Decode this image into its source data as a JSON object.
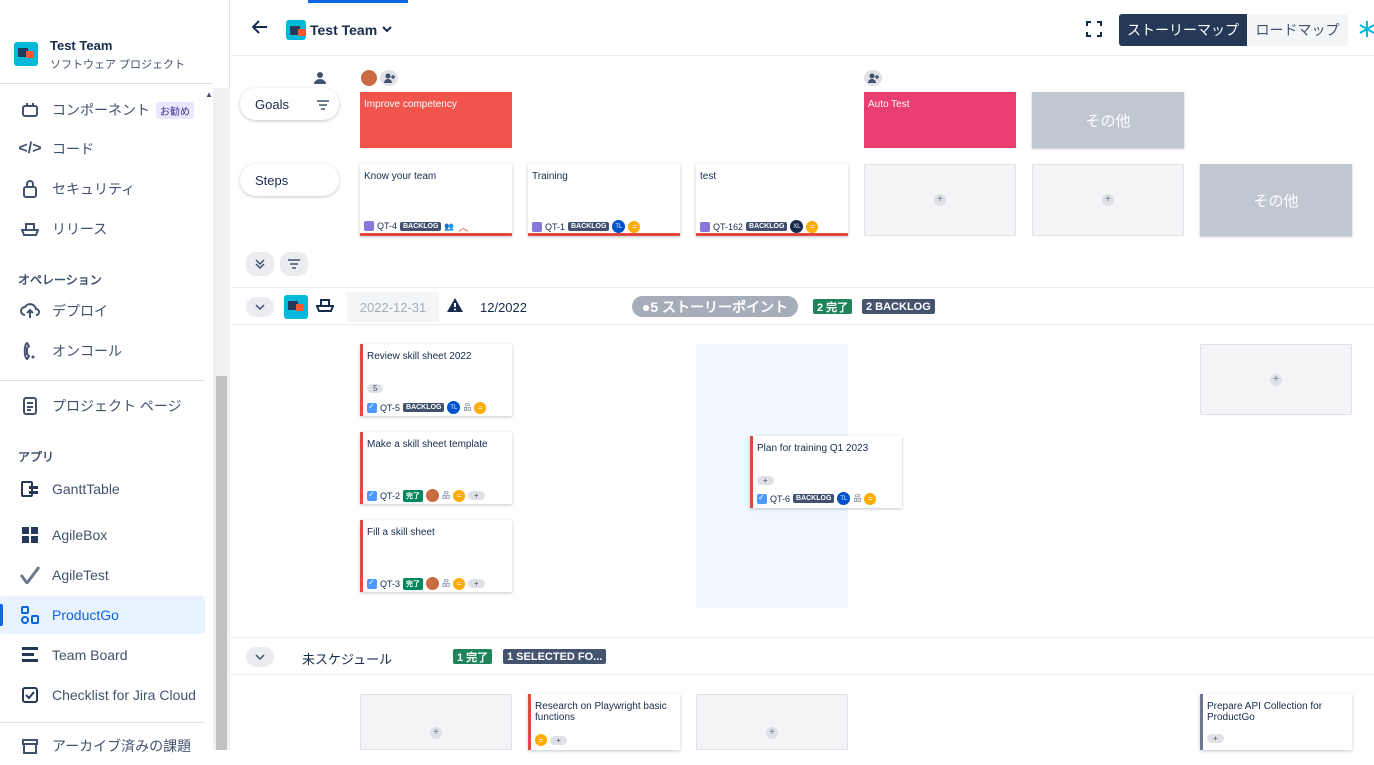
{
  "project": {
    "name": "Test Team",
    "type": "ソフトウェア プロジェクト"
  },
  "sidebar": {
    "items": [
      {
        "label": "コンポーネント",
        "badge": "お勧め",
        "icon": "component-icon"
      },
      {
        "label": "コード",
        "icon": "code-icon"
      },
      {
        "label": "セキュリティ",
        "icon": "lock-icon"
      },
      {
        "label": "リリース",
        "icon": "ship-icon"
      }
    ],
    "operations_title": "オペレーション",
    "operations": [
      {
        "label": "デプロイ",
        "icon": "cloud-upload-icon"
      },
      {
        "label": "オンコール",
        "icon": "phone-icon"
      }
    ],
    "project_page": "プロジェクト ページ",
    "apps_title": "アプリ",
    "apps": [
      {
        "label": "GanttTable",
        "icon": "gantt-icon"
      },
      {
        "label": "AgileBox",
        "icon": "grid-icon"
      },
      {
        "label": "AgileTest",
        "icon": "check-icon"
      },
      {
        "label": "ProductGo",
        "icon": "productgo-icon"
      },
      {
        "label": "Team Board",
        "icon": "board-icon"
      },
      {
        "label": "Checklist for Jira Cloud",
        "icon": "checklist-icon"
      }
    ],
    "archive": "アーカイブ済みの課題"
  },
  "header": {
    "title": "Test Team",
    "views": {
      "story_map": "ストーリーマップ",
      "roadmap": "ロードマップ"
    }
  },
  "rows": {
    "goals": "Goals",
    "steps": "Steps"
  },
  "goals": [
    {
      "label": "Improve competency",
      "color": "#f0544c"
    },
    {
      "label": "Auto Test",
      "color": "#ea3d71"
    }
  ],
  "other_label": "その他",
  "steps": [
    {
      "title": "Know your team",
      "key": "QT-4",
      "status": "BACKLOG"
    },
    {
      "title": "Training",
      "key": "QT-1",
      "status": "BACKLOG",
      "avatar": "TL"
    },
    {
      "title": "test",
      "key": "QT-162",
      "status": "BACKLOG",
      "avatar": "XL"
    }
  ],
  "release": {
    "date": "2022-12-31",
    "name": "12/2022",
    "points": "●5 ストーリーポイント",
    "done": "2 完了",
    "backlog": "2 BACKLOG"
  },
  "release_cards": [
    {
      "title": "Review skill sheet 2022",
      "sp": "5",
      "key": "QT-5",
      "status": "BACKLOG",
      "avatar": "TL"
    },
    {
      "title": "Make a skill sheet template",
      "key": "QT-2",
      "status": "完了"
    },
    {
      "title": "Fill a skill sheet",
      "key": "QT-3",
      "status": "完了"
    },
    {
      "title": "Plan for training Q1 2023",
      "key": "QT-6",
      "status": "BACKLOG",
      "avatar": "TL"
    }
  ],
  "unscheduled": {
    "label": "未スケジュール",
    "done": "1 完了",
    "selected": "1 SELECTED FO..."
  },
  "unscheduled_cards": [
    {
      "title": "Research on Playwright basic functions"
    },
    {
      "title": "Prepare API Collection for ProductGo"
    }
  ],
  "plus": "+"
}
